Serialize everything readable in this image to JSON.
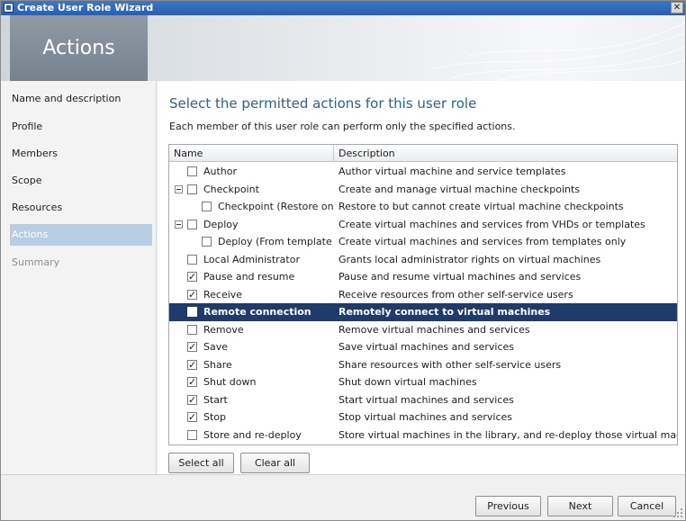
{
  "window": {
    "title": "Create User Role Wizard",
    "close_glyph": "✕"
  },
  "banner": {
    "title": "Actions"
  },
  "sidebar": {
    "items": [
      {
        "label": "Name and description",
        "state": "done"
      },
      {
        "label": "Profile",
        "state": "done"
      },
      {
        "label": "Members",
        "state": "done"
      },
      {
        "label": "Scope",
        "state": "done"
      },
      {
        "label": "Resources",
        "state": "done"
      },
      {
        "label": "Actions",
        "state": "active"
      },
      {
        "label": "Summary",
        "state": "future"
      }
    ]
  },
  "main": {
    "heading": "Select the permitted actions for this user role",
    "subtitle": "Each member of this user role can perform only the specified actions."
  },
  "grid": {
    "columns": [
      "Name",
      "Description"
    ],
    "rows": [
      {
        "name": "Author",
        "description": "Author virtual machine and service templates",
        "checked": false,
        "level": 0,
        "expander": false,
        "selected": false
      },
      {
        "name": "Checkpoint",
        "description": "Create and manage virtual machine checkpoints",
        "checked": false,
        "level": 0,
        "expander": true,
        "selected": false
      },
      {
        "name": "Checkpoint (Restore only)",
        "description": "Restore to but cannot create virtual machine checkpoints",
        "checked": false,
        "level": 1,
        "expander": false,
        "selected": false
      },
      {
        "name": "Deploy",
        "description": "Create virtual machines and services from VHDs or templates",
        "checked": false,
        "level": 0,
        "expander": true,
        "selected": false
      },
      {
        "name": "Deploy (From template only)",
        "description": "Create virtual machines and services from templates only",
        "checked": false,
        "level": 1,
        "expander": false,
        "selected": false
      },
      {
        "name": "Local Administrator",
        "description": "Grants local administrator rights on virtual machines",
        "checked": false,
        "level": 0,
        "expander": false,
        "selected": false
      },
      {
        "name": "Pause and resume",
        "description": "Pause and resume virtual machines and services",
        "checked": true,
        "level": 0,
        "expander": false,
        "selected": false
      },
      {
        "name": "Receive",
        "description": "Receive resources from other self-service users",
        "checked": true,
        "level": 0,
        "expander": false,
        "selected": false
      },
      {
        "name": "Remote connection",
        "description": "Remotely connect to virtual machines",
        "checked": false,
        "level": 0,
        "expander": false,
        "selected": true
      },
      {
        "name": "Remove",
        "description": "Remove virtual machines and services",
        "checked": false,
        "level": 0,
        "expander": false,
        "selected": false
      },
      {
        "name": "Save",
        "description": "Save virtual machines and services",
        "checked": true,
        "level": 0,
        "expander": false,
        "selected": false
      },
      {
        "name": "Share",
        "description": "Share resources with other self-service users",
        "checked": true,
        "level": 0,
        "expander": false,
        "selected": false
      },
      {
        "name": "Shut down",
        "description": "Shut down virtual machines",
        "checked": true,
        "level": 0,
        "expander": false,
        "selected": false
      },
      {
        "name": "Start",
        "description": "Start virtual machines and services",
        "checked": true,
        "level": 0,
        "expander": false,
        "selected": false
      },
      {
        "name": "Stop",
        "description": "Stop virtual machines and services",
        "checked": true,
        "level": 0,
        "expander": false,
        "selected": false
      },
      {
        "name": "Store and re-deploy",
        "description": "Store virtual machines in the library, and re-deploy those virtual machines",
        "checked": false,
        "level": 0,
        "expander": false,
        "selected": false
      }
    ]
  },
  "actions": {
    "select_all": "Select all",
    "clear_all": "Clear all"
  },
  "footer": {
    "previous": "Previous",
    "next": "Next",
    "cancel": "Cancel"
  },
  "colors": {
    "heading": "#2f5f8f",
    "selected_row": "#1f3b6b",
    "active_nav": "#b6cde3",
    "titlebar": "#2a5fab",
    "banner_tile": "#7f8b96"
  },
  "icons": {
    "titlebar": "app-window-icon",
    "close": "close-icon",
    "expander": "collapse-minus-icon",
    "check": "check-mark-icon",
    "grip": "resize-grip-icon"
  }
}
